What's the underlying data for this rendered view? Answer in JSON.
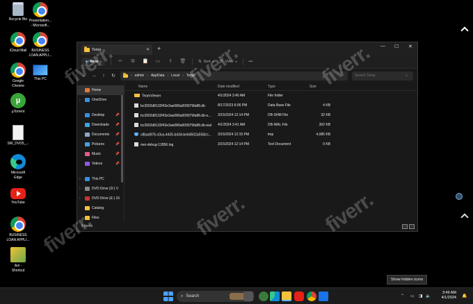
{
  "desktop": {
    "icons": [
      {
        "label": "Recycle Bin",
        "icon": "recycle-bin-icon"
      },
      {
        "label": "Presentation...\n- Microsoft...",
        "icon": "chrome-icon"
      },
      {
        "label": "iCloud Mail",
        "icon": "chrome-icon"
      },
      {
        "label": "BUSINESS\nLOAN APPLI...",
        "icon": "chrome-icon"
      },
      {
        "label": "Google\nChrome",
        "icon": "chrome-icon"
      },
      {
        "label": "This PC",
        "icon": "monitor-icon"
      },
      {
        "label": "µTorrent",
        "icon": "utorrent-icon"
      },
      {
        "label": "SW_DVD5_...",
        "icon": "document-icon"
      },
      {
        "label": "Microsoft\nEdge",
        "icon": "edge-icon"
      },
      {
        "label": "YouTube",
        "icon": "youtube-icon"
      },
      {
        "label": "BUSINESS\nLOAN APPLI...",
        "icon": "chrome-icon"
      },
      {
        "label": "ilun -\nShortcut",
        "icon": "shortcut-icon"
      }
    ]
  },
  "explorer": {
    "tab_title": "Temp",
    "toolbar": {
      "new_label": "New",
      "sort_label": "Sort",
      "view_label": "View",
      "more_label": "•••"
    },
    "address": {
      "segments": [
        "admin",
        "AppData",
        "Local",
        "Temp"
      ],
      "search_placeholder": "Search Temp"
    },
    "sidebar": [
      {
        "label": "Home",
        "selected": true,
        "color": "#e07a3a"
      },
      {
        "label": "OneDrive",
        "color": "#3a8fe0",
        "expand": true
      },
      {
        "label": "Desktop",
        "color": "#3a8fe0",
        "pin": true
      },
      {
        "label": "Downloads",
        "color": "#3aa6e0",
        "pin": true
      },
      {
        "label": "Documents",
        "color": "#8fa8c8",
        "pin": true
      },
      {
        "label": "Pictures",
        "color": "#47a0e0",
        "pin": true
      },
      {
        "label": "Music",
        "color": "#e05a8f",
        "pin": true
      },
      {
        "label": "Videos",
        "color": "#8f5ae0",
        "pin": true
      },
      {
        "label": "This PC",
        "color": "#3a8fe0",
        "expand": true
      },
      {
        "label": "DVD Drive (D:) V",
        "color": "#888888",
        "expand": true
      },
      {
        "label": "DVD Drive (E:) 16",
        "color": "#cc3333",
        "expand": true
      },
      {
        "label": "Catalog",
        "color": "#f3c23d"
      },
      {
        "label": "Files",
        "color": "#f3c23d"
      }
    ],
    "columns": [
      "Name",
      "Date modified",
      "Type",
      "Size"
    ],
    "files": [
      {
        "name": "TeamViewer",
        "date": "4/1/2024 3:40 AM",
        "type": "File folder",
        "size": "",
        "kind": "dir"
      },
      {
        "name": "bc3902d8132f43e3ae086a009979fa88.db",
        "date": "8/17/2023 6:06 PM",
        "type": "Data Base File",
        "size": "4 KB",
        "kind": "file"
      },
      {
        "name": "bc3902d8132f43e3ae086a009979fa88.db-s...",
        "date": "3/15/2024 12:14 PM",
        "type": "DB-SHM File",
        "size": "32 KB",
        "kind": "file"
      },
      {
        "name": "bc3902d8132f43e3ae086a009979fa88.db-wal",
        "date": "4/1/2024 3:41 AM",
        "type": "DB-WAL File",
        "size": "302 KB",
        "kind": "file"
      },
      {
        "name": "c8bad976-c0ca-4435-b434-be6d502a558d.t...",
        "date": "3/15/2024 12:15 PM",
        "type": "tmp",
        "size": "4,085 KB",
        "kind": "tmp"
      },
      {
        "name": "mei-debug-12856.log",
        "date": "3/15/2024 12:14 PM",
        "type": "Text Document",
        "size": "0 KB",
        "kind": "file"
      }
    ],
    "status": "6 items"
  },
  "tooltip": "Show hidden icons",
  "taskbar": {
    "search_label": "Search",
    "time": "3:49 AM",
    "date": "4/1/2024"
  },
  "watermark": "fiverr."
}
